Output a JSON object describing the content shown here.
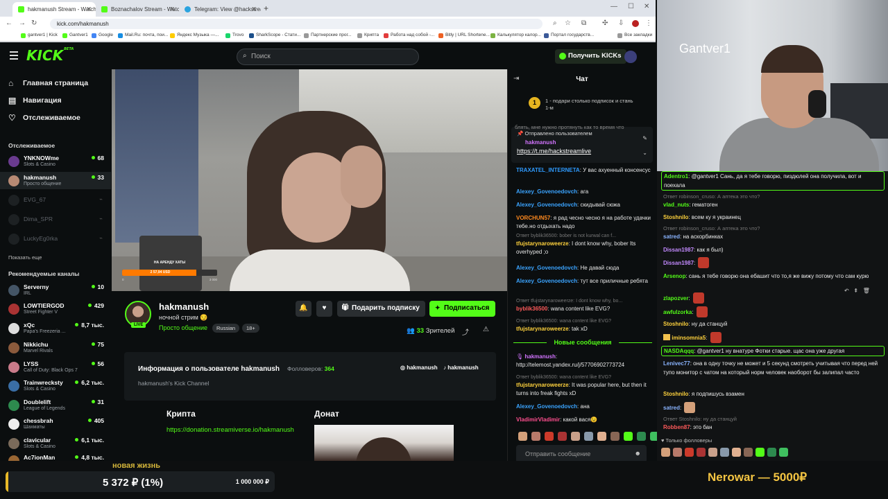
{
  "browser": {
    "tabs": [
      {
        "title": "hakmanush Stream - Watch Li",
        "favicon_color": "#53fc18",
        "active": true
      },
      {
        "title": "Boznachalov Stream - Watch Li",
        "favicon_color": "#53fc18",
        "active": false
      },
      {
        "title": "Telegram: View @hackstreamli",
        "favicon_color": "#2aa3df",
        "active": false
      }
    ],
    "url": "kick.com/hakmanush",
    "bookmarks": [
      {
        "label": "gantver1 | Kick",
        "color": "#53fc18"
      },
      {
        "label": "Gantver1",
        "color": "#53fc18"
      },
      {
        "label": "Google",
        "color": "#4285f4"
      },
      {
        "label": "Mail.Ru: почта, пои...",
        "color": "#168de2"
      },
      {
        "label": "Яндекс Музыка —...",
        "color": "#ffcc00"
      },
      {
        "label": "Trovo",
        "color": "#19d66b"
      },
      {
        "label": "SharkScope - Стати...",
        "color": "#1b4f8a"
      },
      {
        "label": "Партнерские прог...",
        "color": "#999999"
      },
      {
        "label": "Крипта",
        "color": "#999999"
      },
      {
        "label": "Работа над собой -...",
        "color": "#e23c3c"
      },
      {
        "label": "Bitly | URL Shortene...",
        "color": "#ee6123"
      },
      {
        "label": "Калькулятор калор...",
        "color": "#7cb342"
      },
      {
        "label": "Портал государств...",
        "color": "#3b5998"
      },
      {
        "label": "Все закладки",
        "color": "#999999"
      }
    ]
  },
  "header": {
    "logo": "KICK",
    "logo_sup": "BETA",
    "search_placeholder": "Поиск",
    "get_kicks": "Получить KICKs"
  },
  "sidebar": {
    "nav": [
      {
        "label": "Главная страница",
        "icon": "home-icon",
        "glyph": "⌂"
      },
      {
        "label": "Навигация",
        "icon": "browse-icon",
        "glyph": "▤"
      },
      {
        "label": "Отслеживаемое",
        "icon": "heart-icon",
        "glyph": "♡"
      }
    ],
    "following_title": "Отслеживаемое",
    "following": [
      {
        "name": "YNKNOWme",
        "category": "Slots & Casino",
        "viewers": "68",
        "color": "#6a3b8f"
      },
      {
        "name": "hakmanush",
        "category": "Просто общение",
        "viewers": "33",
        "color": "#b88a74"
      },
      {
        "name": "EVG_67",
        "offline": true
      },
      {
        "name": "Dima_SPR",
        "offline": true
      },
      {
        "name": "LuckyEg0rka",
        "offline": true
      }
    ],
    "show_more": "Показать еще",
    "recommended_title": "Рекомендуемые каналы",
    "recommended": [
      {
        "name": "Serverny",
        "category": "IRL",
        "viewers": "10",
        "color": "#445566"
      },
      {
        "name": "LOWTIERGOD",
        "category": "Street Fighter V",
        "viewers": "429",
        "color": "#aa3333"
      },
      {
        "name": "xQc",
        "category": "Papa's Freezeria ...",
        "viewers": "8,7 тыс.",
        "color": "#dddddd"
      },
      {
        "name": "Nikkichu",
        "category": "Marvel Rivals",
        "viewers": "75",
        "color": "#8b5a3c"
      },
      {
        "name": "LYSS",
        "category": "Call of Duty: Black Ops 7",
        "viewers": "56",
        "color": "#c97b8a"
      },
      {
        "name": "Trainwrecksty",
        "category": "Slots & Casino",
        "viewers": "6,2 тыс.",
        "color": "#3a6ea5"
      },
      {
        "name": "Doublelift",
        "category": "League of Legends",
        "viewers": "31",
        "color": "#2d8a4e"
      },
      {
        "name": "chessbrah",
        "category": "Шахматы",
        "viewers": "405",
        "color": "#eeeeee"
      },
      {
        "name": "clavicular",
        "category": "Slots & Casino",
        "viewers": "6,1 тыс.",
        "color": "#7a6a5a"
      },
      {
        "name": "Ac7ionMan",
        "category": "",
        "viewers": "4,8 тыс.",
        "color": "#996633"
      }
    ]
  },
  "video": {
    "banner_label": "НА АРЕНДУ ХАТЫ",
    "banner_amount": "2 57,94 USD",
    "banner_progress": 0.78,
    "banner_min": "0",
    "banner_max": "3 000"
  },
  "channel": {
    "name": "hakmanush",
    "title": "ночной стрим 😏",
    "category": "Просто общение",
    "tags": [
      "Russian",
      "18+"
    ],
    "live": "LIVE",
    "gift_label": "Подарить подписку",
    "subscribe_label": "Подписаться",
    "viewers_count": "33",
    "viewers_label": "Зрителей",
    "about_title": "Информация о пользователе hakmanush",
    "followers_label": "Фолловеров:",
    "followers_count": "364",
    "about_desc": "hakmanush's Kick Channel",
    "socials": [
      {
        "label": "hakmanush",
        "icon": "instagram-icon",
        "glyph": "◎"
      },
      {
        "label": "hakmanush",
        "icon": "tiktok-icon",
        "glyph": "♪"
      }
    ],
    "panel1_title": "Крипта",
    "panel1_link": "https://donation.streamiverse.io/hakmanush",
    "panel2_title": "Донат"
  },
  "chat": {
    "title": "Чат",
    "goal_number": "1",
    "goal_text": "1 - подари столько подписок и стань 1-м",
    "pinned_cut": "блять, мне нужно протянуть как то время что",
    "pinned_header": "Отправлено пользователем",
    "pinned_user": "hakmanush",
    "pinned_link": "https://t.me/hackstreamlive",
    "messages": [
      {
        "user": "TRAXATEL_INTERNETA",
        "color": "#2f9bff",
        "text": "У вас ахуенный консенсус"
      },
      {
        "user": "Alexey_Govenoedovch",
        "color": "#3ba4ff",
        "text": "ага"
      },
      {
        "user": "Alexey_Govenoedovch",
        "color": "#3ba4ff",
        "text": "скидывай сюжа"
      },
      {
        "user": "VORCHUN57",
        "color": "#ff8a1f",
        "text": "я рад чесно чесно я на работе удачки тебе.но отдыхать надо"
      },
      {
        "reply": "Ответ byblik36500: bober is not kurwal can f...",
        "user": "tfujstarynaroweerze",
        "color": "#ffd23d",
        "text": "I dont know why, bober Its overhyped ;o"
      },
      {
        "user": "Alexey_Govenoedovch",
        "color": "#3ba4ff",
        "text": "Не давай сюда"
      },
      {
        "user": "Alexey_Govenoedovch",
        "color": "#3ba4ff",
        "text": "тут все приличные ребята"
      },
      {
        "reply": "Ответ tfujstarynaroweerze: I dont know why, bo...",
        "user": "byblik36500",
        "color": "#ff5a5a",
        "text": "wana content like EVG?"
      },
      {
        "reply": "Ответ byblik36500: wana content like EVG?",
        "user": "tfujstarynaroweerze",
        "color": "#ffd23d",
        "text": "tak xD"
      }
    ],
    "new_messages_label": "Новые сообщения",
    "new_messages": [
      {
        "user": "hakmanush",
        "color": "#d274ff",
        "text": "http://telemost.yandex.ru/j/57706902773724"
      },
      {
        "reply": "Ответ byblik36500: wana content like EVG?",
        "user": "tfujstarynaroweerze",
        "color": "#ffd23d",
        "text": "It was popular here, but then it turns into freak fights xD"
      },
      {
        "user": "Alexey_Govenoedovch",
        "color": "#3ba4ff",
        "text": "ана"
      },
      {
        "user": "VladimirVladimir",
        "color": "#ff4f8f",
        "text": "какой вася😉"
      }
    ],
    "input_placeholder": "Отправить сообщение",
    "emote_colors": [
      "#d4a07a",
      "#b87a6a",
      "#cc3a2a",
      "#a33",
      "#c9a08a",
      "#8899aa",
      "#e0b090",
      "#886655",
      "#53fc18",
      "#2d8a4e",
      "#3fbf5f"
    ]
  },
  "webcam": {
    "name": "Gantver1"
  },
  "overlay_chat": {
    "messages": [
      {
        "user": "Adentro1",
        "color": "#53fc18",
        "text": "@gantver1 Сань, да я тебе говорю, пиздюлей она получила, вот и поехала",
        "highlight": true
      },
      {
        "reply": "Ответ robinson_cruso: А аптека это что?",
        "user": "vlad_nuts",
        "color": "#53fc18",
        "text": "гематоген"
      },
      {
        "user": "Stoshnilo",
        "color": "#ffd23d",
        "text": "всем ку я украинец"
      },
      {
        "reply": "Ответ robinson_cruso: А аптека это что?",
        "user": "satred",
        "color": "#8ab4ff",
        "text": "на аскорбинках"
      },
      {
        "user": "Dissan1987",
        "color": "#c38aff",
        "text": "как я был)"
      },
      {
        "user": "Dissan1987",
        "color": "#c38aff",
        "text": "",
        "emote": "#c0392b"
      },
      {
        "user": "Arsenop",
        "color": "#53fc18",
        "text": "сань я тебе говорю она ебашит что то,я же вижу потому что сам курю"
      },
      {
        "user": "zlapozver",
        "color": "#53fc18",
        "text": "",
        "emote": "#c0392b"
      },
      {
        "user": "awfulzorka",
        "color": "#53fc18",
        "text": "",
        "emote": "#c0392b"
      },
      {
        "user": "Stoshnilo",
        "color": "#ffd23d",
        "text": "ну да станцуй"
      },
      {
        "user": "iminsomnia5",
        "color": "#ffd23d",
        "text": "",
        "emote": "#c0392b"
      },
      {
        "user": "NASDAqqq",
        "color": "#53fc18",
        "text": "@gantver1 ну внатуре Фотки старые. щас она уже другая",
        "highlight": true
      },
      {
        "user": "Lenivec77",
        "color": "#8ab4ff",
        "text": "она в одну точку не может и 5 секунд смотреть учитывая что перед ней тупо монитор с чатом на который норм человек наоборот бы залипал часто"
      },
      {
        "user": "Stoshnilo",
        "color": "#ffd23d",
        "text": "я подпишусь взамен"
      },
      {
        "user": "satred",
        "color": "#8ab4ff",
        "text": "",
        "emote": "#d4a07a"
      },
      {
        "reply": "Ответ Stoshnilo: ну да станцуй",
        "user": "Robben87",
        "color": "#ff5a5a",
        "text": "это бан"
      }
    ],
    "followers_only": "Только фолловеры"
  },
  "bottom": {
    "cut_title": "новая жизнь",
    "donation_current": "5 372 ₽ (1%)",
    "donation_goal": "1 000 000 ₽",
    "donation_progress": 0.01,
    "top_donor": "Nerowar — 5000₽"
  }
}
